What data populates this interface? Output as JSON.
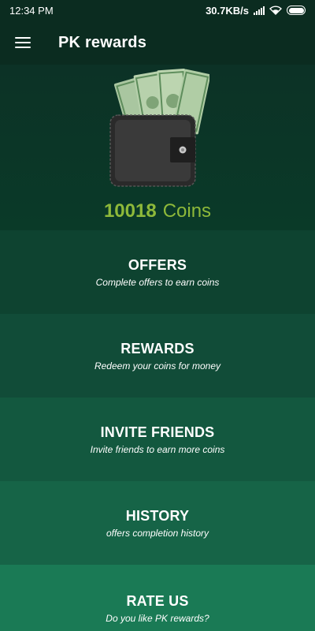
{
  "status_bar": {
    "time": "12:34 PM",
    "network_speed": "30.7KB/s",
    "icons": [
      "signal-icon",
      "wifi-icon",
      "battery-icon"
    ]
  },
  "app_bar": {
    "title": "PK rewards",
    "menu_icon": "hamburger-menu-icon"
  },
  "balance": {
    "amount": "10018",
    "unit": "Coins",
    "image": "wallet-with-cash-icon"
  },
  "menu": [
    {
      "title": "OFFERS",
      "subtitle": "Complete offers to earn coins"
    },
    {
      "title": "REWARDS",
      "subtitle": "Redeem your coins for money"
    },
    {
      "title": "INVITE FRIENDS",
      "subtitle": "Invite friends to earn more coins"
    },
    {
      "title": "HISTORY",
      "subtitle": "offers completion history"
    },
    {
      "title": "RATE US",
      "subtitle": "Do you like PK rewards?"
    }
  ],
  "colors": {
    "background": "#0c3325",
    "accent": "#8eb93a",
    "card_1": "#0e4330",
    "card_5": "#1a7a55"
  }
}
